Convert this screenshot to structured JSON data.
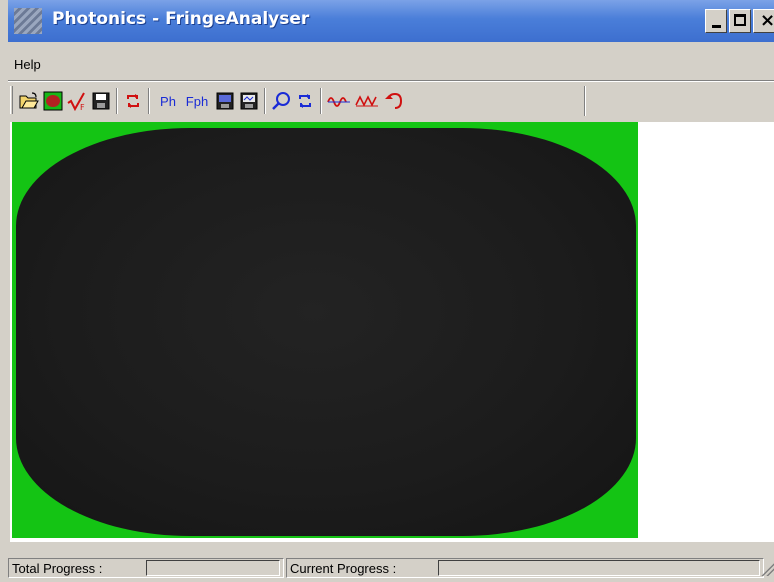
{
  "window": {
    "title": "Photonics - FringeAnalyser",
    "controls": {
      "minimize": "-",
      "maximize": "□",
      "close": "×"
    }
  },
  "menu": {
    "items": [
      {
        "label": "Help"
      }
    ]
  },
  "toolbar": {
    "buttons": [
      {
        "name": "open-icon"
      },
      {
        "name": "mask-icon"
      },
      {
        "name": "filter-icon"
      },
      {
        "name": "save-icon"
      },
      {
        "name": "refresh-icon"
      },
      {
        "name": "phase-button",
        "label": "Ph"
      },
      {
        "name": "filtered-phase-button",
        "label": "Fph"
      },
      {
        "name": "save-image-icon"
      },
      {
        "name": "save-phase-icon"
      },
      {
        "name": "zoom-icon"
      },
      {
        "name": "swap-icon"
      },
      {
        "name": "wave-icon"
      },
      {
        "name": "unwrap-icon"
      },
      {
        "name": "undo-icon"
      }
    ]
  },
  "statusbar": {
    "total_progress_label": "Total Progress :",
    "current_progress_label": "Current Progress :",
    "total_progress_value": 0,
    "current_progress_value": 0
  },
  "colors": {
    "titlebar": "#3d6fcf",
    "mask_green": "#14c414",
    "fringe_dark": "#1c1c1c",
    "toolbar_text": "#1a2bd6"
  }
}
